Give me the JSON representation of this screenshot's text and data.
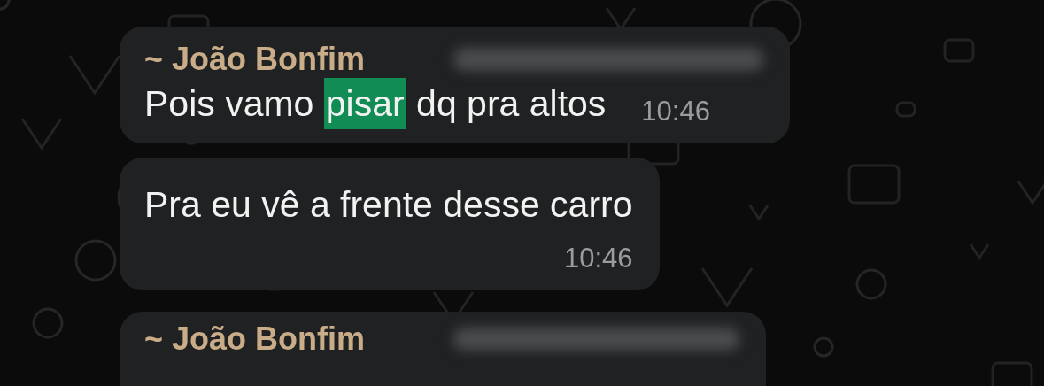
{
  "messages": [
    {
      "sender": "~ João Bonfim",
      "sender_number_redacted": true,
      "parts": [
        {
          "text": "Pois vamo ",
          "highlighted": false
        },
        {
          "text": "pisar",
          "highlighted": true
        },
        {
          "text": " dq pra altos",
          "highlighted": false
        }
      ],
      "time": "10:46",
      "time_below": false
    },
    {
      "parts": [
        {
          "text": "Pra eu vê a frente desse carro",
          "highlighted": false
        }
      ],
      "time": "10:46",
      "time_below": true
    },
    {
      "sender": "~ João Bonfim",
      "sender_number_redacted": true
    }
  ]
}
